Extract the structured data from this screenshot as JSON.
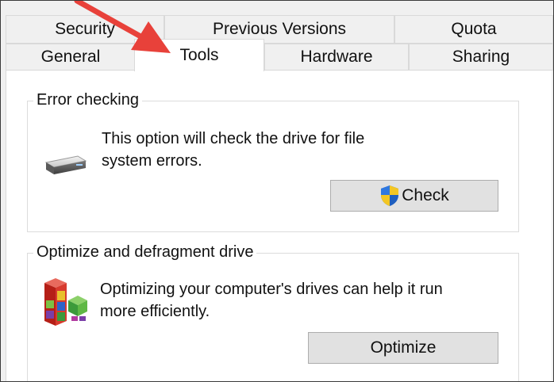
{
  "tabs_row1": [
    {
      "label": "Security"
    },
    {
      "label": "Previous Versions"
    },
    {
      "label": "Quota"
    }
  ],
  "tabs_row2": [
    {
      "label": "General"
    },
    {
      "label": "Tools",
      "active": true
    },
    {
      "label": "Hardware"
    },
    {
      "label": "Sharing"
    }
  ],
  "error_checking": {
    "title": "Error checking",
    "description_line1": "This option will check the drive for file",
    "description_line2": "system errors.",
    "button_label": "Check",
    "icon": "drive-icon",
    "button_icon": "uac-shield-icon"
  },
  "optimize": {
    "title": "Optimize and defragment drive",
    "description_line1": "Optimizing your computer's drives can help it run",
    "description_line2": "more efficiently.",
    "button_label": "Optimize",
    "icon": "defrag-icon"
  },
  "annotation": {
    "icon": "arrow-icon",
    "color": "#e8413a"
  },
  "colors": {
    "panel_bg": "#ffffff",
    "window_bg": "#f0f0f0",
    "button_bg": "#e1e1e1",
    "button_border": "#adadad",
    "border": "#d9d9d9"
  }
}
